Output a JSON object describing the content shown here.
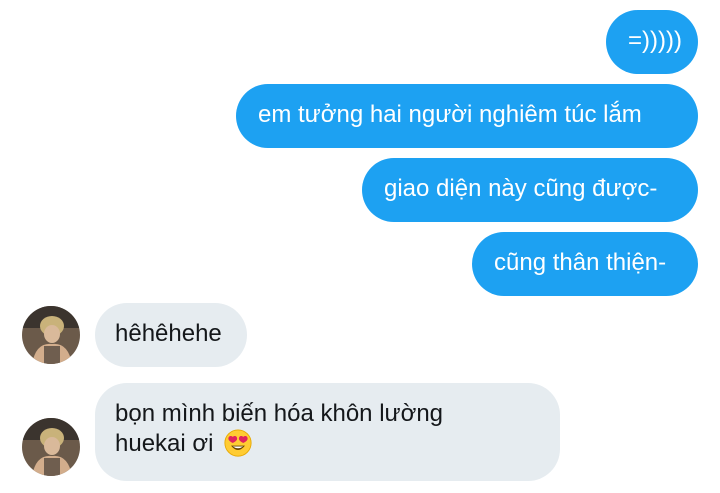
{
  "outgoing": [
    {
      "text": "=)))))"
    },
    {
      "text": "em tưởng hai người nghiêm túc lắm"
    },
    {
      "text": "giao diện này cũng được-"
    },
    {
      "text": "cũng thân thiện-"
    }
  ],
  "incoming": [
    {
      "text": "hêhêhehe"
    },
    {
      "line1": "bọn mình biến hóa khôn lường",
      "line2": "huekai ơi",
      "emoji": "heart-eyes-emoji"
    }
  ],
  "avatar": {
    "name": "avatar-icon"
  },
  "colors": {
    "outgoing_bubble": "#1da1f2",
    "incoming_bubble": "#e6ecf0"
  }
}
